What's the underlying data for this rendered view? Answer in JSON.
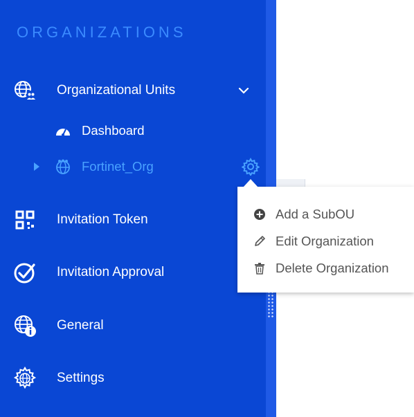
{
  "sidebar": {
    "section_title": "ORGANIZATIONS",
    "items": [
      {
        "label": "Organizational Units",
        "icon": "globe-users-icon",
        "expanded": true
      },
      {
        "label": "Invitation Token",
        "icon": "qr-code-icon"
      },
      {
        "label": "Invitation Approval",
        "icon": "check-circle-icon"
      },
      {
        "label": "General",
        "icon": "globe-info-icon"
      },
      {
        "label": "Settings",
        "icon": "gear-globe-icon"
      }
    ],
    "sub_items": [
      {
        "label": "Dashboard",
        "icon": "speedometer-icon"
      },
      {
        "label": "Fortinet_Org",
        "icon": "globe-users-icon",
        "active": true
      }
    ]
  },
  "context_menu": {
    "items": [
      {
        "label": "Add a SubOU",
        "icon": "plus-circle-icon"
      },
      {
        "label": "Edit Organization",
        "icon": "pencil-icon"
      },
      {
        "label": "Delete Organization",
        "icon": "trash-icon"
      }
    ]
  },
  "colors": {
    "sidebar_bg": "#0a47d4",
    "sidebar_edge": "#1f5ae6",
    "accent": "#49a2ff",
    "title": "#3b8bff",
    "menu_text": "#555555"
  }
}
